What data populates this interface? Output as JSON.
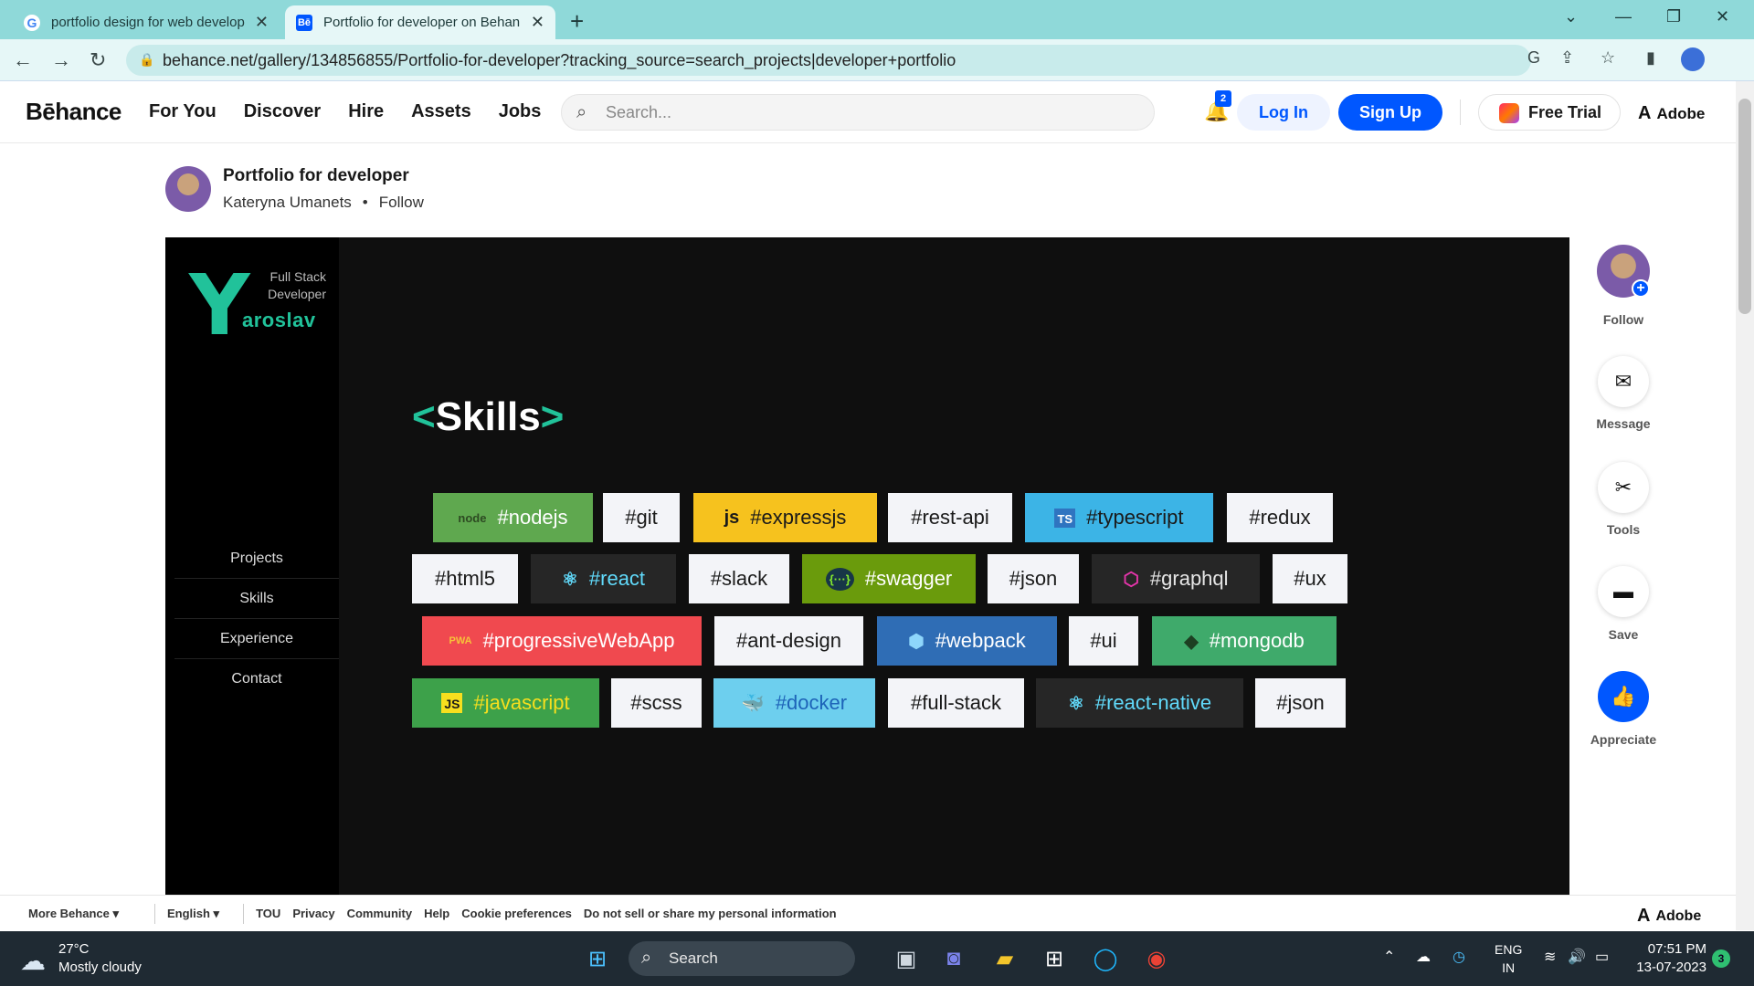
{
  "browser": {
    "tabs": [
      {
        "label": "portfolio design for web develop",
        "favicon": "G",
        "active": false
      },
      {
        "label": "Portfolio for developer on Behan",
        "favicon": "Bē",
        "active": true
      }
    ],
    "url": "behance.net/gallery/134856855/Portfolio-for-developer?tracking_source=search_projects|developer+portfolio"
  },
  "header": {
    "logo": "Bēhance",
    "nav": [
      "For You",
      "Discover",
      "Hire",
      "Assets",
      "Jobs"
    ],
    "search_placeholder": "Search...",
    "notifications_count": "2",
    "login": "Log In",
    "signup": "Sign Up",
    "free_trial": "Free Trial",
    "adobe": "Adobe"
  },
  "project": {
    "title": "Portfolio for developer",
    "author": "Kateryna Umanets",
    "dot": "•",
    "follow": "Follow"
  },
  "artwork": {
    "logo_letter": "Y",
    "logo_name": "aroslav",
    "subtitle_line1": "Full Stack",
    "subtitle_line2": "Developer",
    "menu": [
      "Projects",
      "Skills",
      "Experience",
      "Contact"
    ],
    "heading_open": "<",
    "heading": "Skills",
    "heading_close": ">",
    "tags": [
      {
        "label": "#nodejs",
        "icon": "node",
        "bg": "#5fa84f",
        "fg": "#ffffff"
      },
      {
        "label": "#git",
        "icon": "",
        "bg": "#f3f4f8",
        "fg": "#1a1a1a"
      },
      {
        "label": "#expressjs",
        "icon": "js",
        "bg": "#f6c21e",
        "fg": "#1a1a1a"
      },
      {
        "label": "#rest-api",
        "icon": "",
        "bg": "#f3f4f8",
        "fg": "#1a1a1a"
      },
      {
        "label": "#typescript",
        "icon": "TS",
        "bg": "#3cb4e6",
        "fg": "#1a1a1a"
      },
      {
        "label": "#redux",
        "icon": "",
        "bg": "#f3f4f8",
        "fg": "#1a1a1a"
      },
      {
        "label": "#html5",
        "icon": "",
        "bg": "#f3f4f8",
        "fg": "#1a1a1a"
      },
      {
        "label": "#react",
        "icon": "⚛",
        "bg": "#262626",
        "fg": "#61dafb"
      },
      {
        "label": "#slack",
        "icon": "",
        "bg": "#f3f4f8",
        "fg": "#1a1a1a"
      },
      {
        "label": "#swagger",
        "icon": "{···}",
        "bg": "#6a9b0c",
        "fg": "#ffffff"
      },
      {
        "label": "#json",
        "icon": "",
        "bg": "#f3f4f8",
        "fg": "#1a1a1a"
      },
      {
        "label": "#graphql",
        "icon": "⬡",
        "bg": "#262626",
        "fg": "#e6e6e6"
      },
      {
        "label": "#ux",
        "icon": "",
        "bg": "#f3f4f8",
        "fg": "#1a1a1a"
      },
      {
        "label": "#progressiveWebApp",
        "icon": "PWA",
        "bg": "#f0494f",
        "fg": "#ffffff"
      },
      {
        "label": "#ant-design",
        "icon": "",
        "bg": "#f3f4f8",
        "fg": "#1a1a1a"
      },
      {
        "label": "#webpack",
        "icon": "⬢",
        "bg": "#2f6db5",
        "fg": "#ffffff"
      },
      {
        "label": "#ui",
        "icon": "",
        "bg": "#f3f4f8",
        "fg": "#1a1a1a"
      },
      {
        "label": "#mongodb",
        "icon": "◆",
        "bg": "#3faa6b",
        "fg": "#ffffff"
      },
      {
        "label": "#javascript",
        "icon": "JS",
        "bg": "#3da14a",
        "fg": "#f7df1e"
      },
      {
        "label": "#scss",
        "icon": "",
        "bg": "#f3f4f8",
        "fg": "#1a1a1a"
      },
      {
        "label": "#docker",
        "icon": "🐳",
        "bg": "#6dcfee",
        "fg": "#1d63b8"
      },
      {
        "label": "#full-stack",
        "icon": "",
        "bg": "#f3f4f8",
        "fg": "#1a1a1a"
      },
      {
        "label": "#react-native",
        "icon": "⚛",
        "bg": "#262626",
        "fg": "#61dafb"
      },
      {
        "label": "#json",
        "icon": "",
        "bg": "#f3f4f8",
        "fg": "#1a1a1a"
      }
    ]
  },
  "rail": {
    "follow": "Follow",
    "message": "Message",
    "tools": "Tools",
    "save": "Save",
    "appreciate": "Appreciate"
  },
  "footer": {
    "more": "More Behance ▾",
    "language": "English ▾",
    "links": [
      "TOU",
      "Privacy",
      "Community",
      "Help",
      "Cookie preferences",
      "Do not sell or share my personal information"
    ],
    "adobe": "Adobe"
  },
  "taskbar": {
    "temp": "27°C",
    "weather": "Mostly cloudy",
    "search": "Search",
    "lang1": "ENG",
    "lang2": "IN",
    "time": "07:51 PM",
    "date": "13-07-2023",
    "notif": "3"
  }
}
